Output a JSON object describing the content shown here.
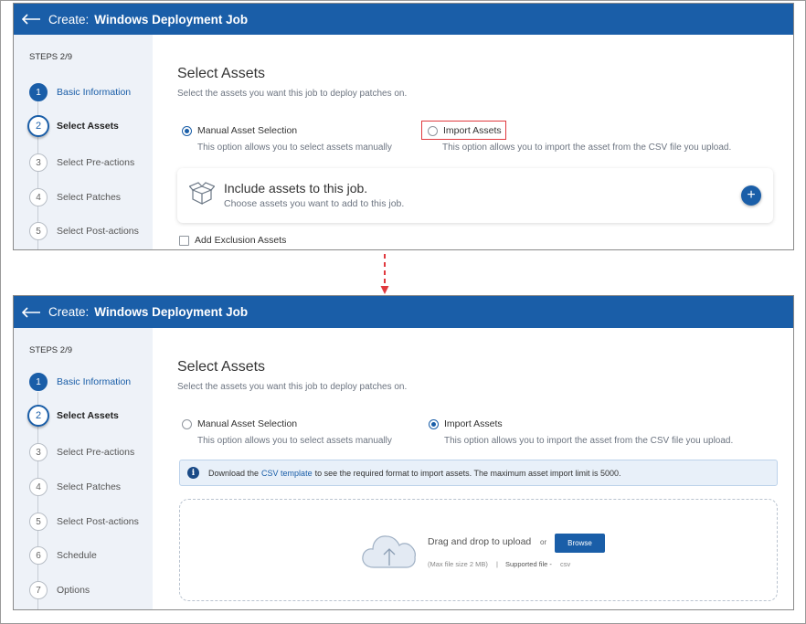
{
  "colors": {
    "primary": "#1a5ea8",
    "highlight": "#e0393e",
    "sidebar_bg": "#eef2f8",
    "arrow": "#e0393e"
  },
  "before": {
    "header": {
      "back_icon": "back-arrow-icon",
      "prefix": "Create:",
      "title": "Windows Deployment Job"
    },
    "sidebar": {
      "steps_label": "STEPS 2/9",
      "steps": [
        {
          "num": "1",
          "label": "Basic Information"
        },
        {
          "num": "2",
          "label": "Select Assets"
        },
        {
          "num": "3",
          "label": "Select Pre-actions"
        },
        {
          "num": "4",
          "label": "Select Patches"
        },
        {
          "num": "5",
          "label": "Select Post-actions"
        }
      ]
    },
    "main": {
      "title": "Select Assets",
      "subtitle": "Select the assets you want this job to deploy patches on.",
      "option_manual": {
        "label": "Manual Asset Selection",
        "description": "This option allows you to select assets manually",
        "selected": true
      },
      "option_import": {
        "label": "Import Assets",
        "description": "This option allows you to import the asset from the CSV file you upload.",
        "selected": false
      },
      "include_card": {
        "icon": "box-icon",
        "title": "Include assets to this job.",
        "subtitle": "Choose assets you want to add to this job.",
        "add_button": "+"
      },
      "exclusion_checkbox": {
        "label": "Add Exclusion Assets",
        "checked": false
      }
    }
  },
  "after": {
    "header": {
      "back_icon": "back-arrow-icon",
      "prefix": "Create:",
      "title": "Windows Deployment Job"
    },
    "sidebar": {
      "steps_label": "STEPS 2/9",
      "steps": [
        {
          "num": "1",
          "label": "Basic Information"
        },
        {
          "num": "2",
          "label": "Select Assets"
        },
        {
          "num": "3",
          "label": "Select Pre-actions"
        },
        {
          "num": "4",
          "label": "Select Patches"
        },
        {
          "num": "5",
          "label": "Select Post-actions"
        },
        {
          "num": "6",
          "label": "Schedule"
        },
        {
          "num": "7",
          "label": "Options"
        }
      ]
    },
    "main": {
      "title": "Select Assets",
      "subtitle": "Select the assets you want this job to deploy patches on.",
      "option_manual": {
        "label": "Manual Asset Selection",
        "description": "This option allows you to select assets manually",
        "selected": false
      },
      "option_import": {
        "label": "Import Assets",
        "description": "This option allows you to import the asset from the CSV file you upload.",
        "selected": true
      },
      "info": {
        "icon": "info-icon",
        "prefix": "Download the",
        "link": "CSV template",
        "suffix": "to see the required format to import assets. The maximum asset import limit is 5000."
      },
      "upload": {
        "icon": "cloud-upload-icon",
        "drag_text": "Drag and drop to upload",
        "or": "or",
        "browse": "Browse",
        "max_size": "(Max file size 2 MB)",
        "separator": "|",
        "supported_label": "Supported file -",
        "supported_value": "csv"
      }
    }
  }
}
